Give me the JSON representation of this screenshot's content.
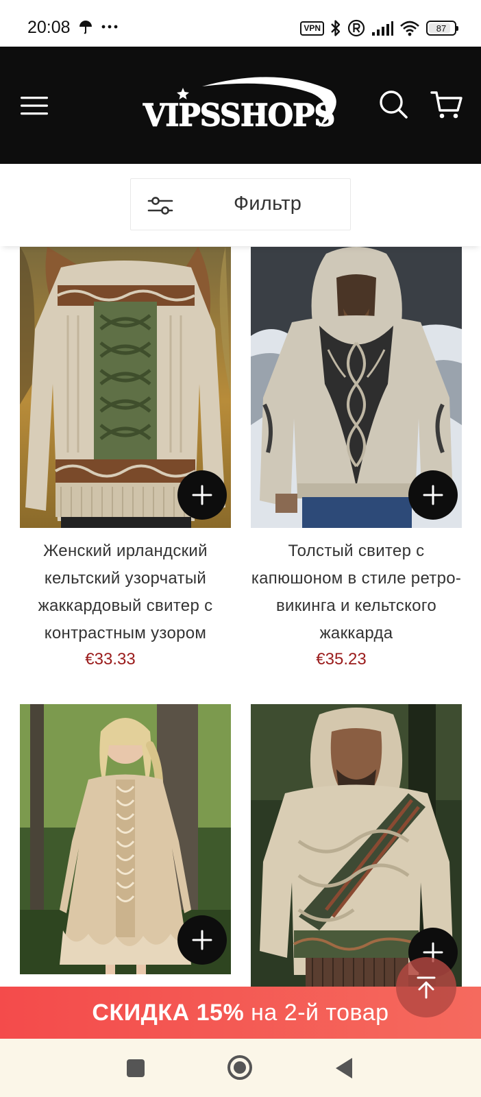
{
  "status_bar": {
    "time": "20:08",
    "vpn": "VPN",
    "battery": "87",
    "battery_level": 0.87
  },
  "header": {
    "logo_text": "VIPSSHOPS"
  },
  "filter": {
    "label": "Фильтр"
  },
  "products": [
    {
      "title": "Женский ирландский кельтский узорчатый жаккардовый свитер с контрастным узором",
      "price": "€33.33"
    },
    {
      "title": "Толстый свитер с капюшоном в стиле ретро-викинга и кельтского жаккарда",
      "price": "€35.23"
    },
    {
      "title": "",
      "price": ""
    },
    {
      "title": "",
      "price": ""
    }
  ],
  "promo": {
    "strong": "СКИДКА 15%",
    "rest": " на 2-й товар"
  },
  "colors": {
    "header_bg": "#0d0d0d",
    "price": "#9a1b1b",
    "promo_bg": "#f44b4b",
    "nav_bg": "#fbf6e8"
  },
  "icons": {
    "menu": "hamburger-menu-icon",
    "search": "search-icon",
    "cart": "cart-icon",
    "filter": "sliders-icon",
    "add": "plus-icon",
    "back_to_top": "arrow-up-icon"
  }
}
